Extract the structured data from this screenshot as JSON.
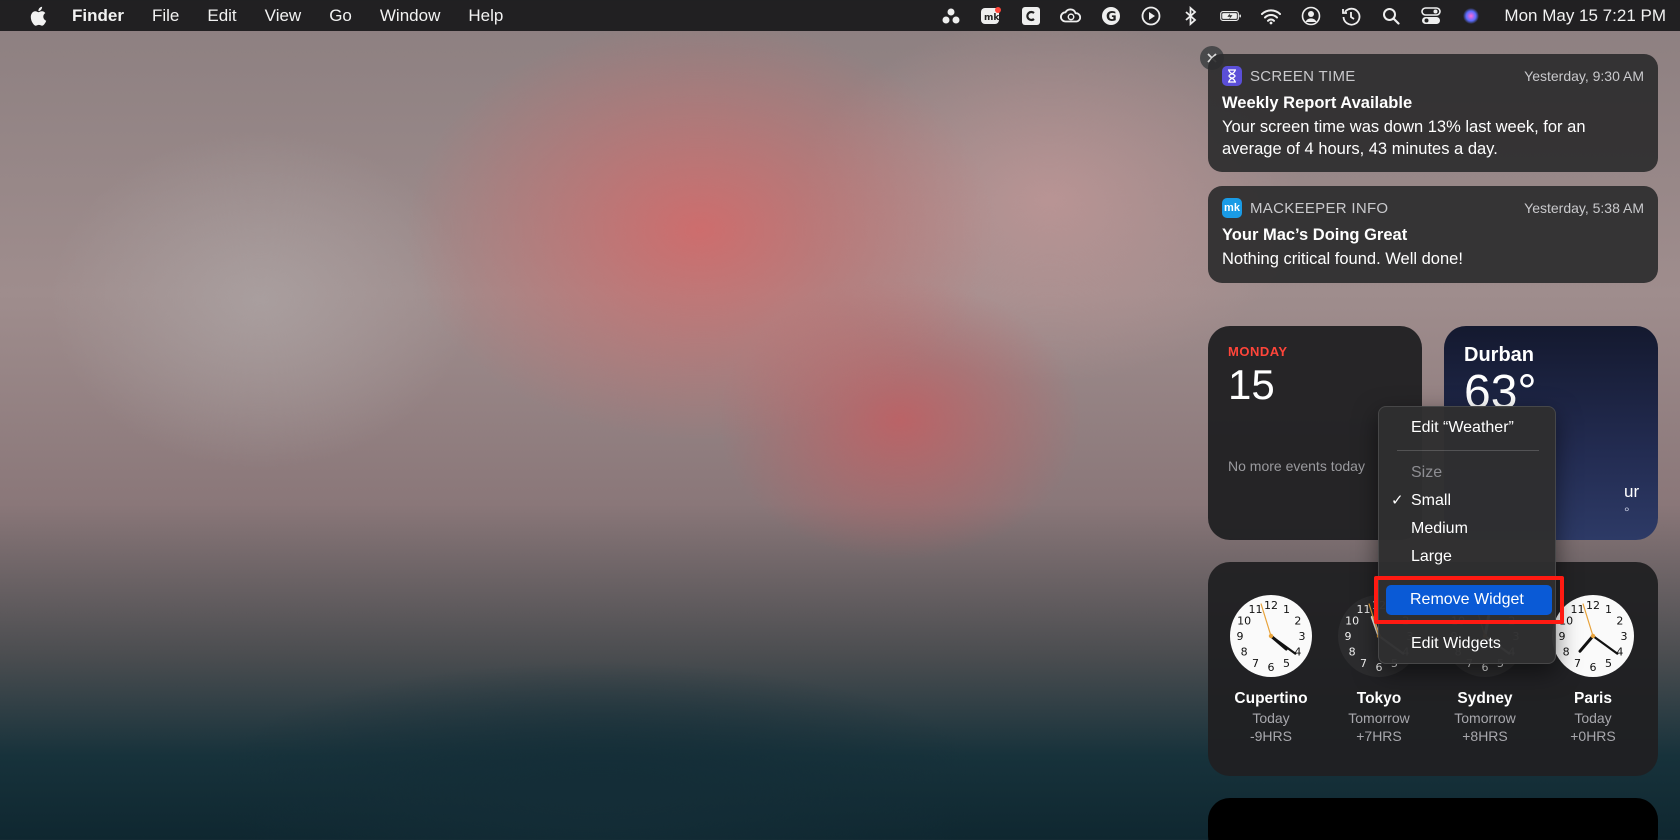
{
  "menubar": {
    "app_name": "Finder",
    "items": [
      "File",
      "Edit",
      "View",
      "Go",
      "Window",
      "Help"
    ],
    "datetime": "Mon May 15  7:21 PM"
  },
  "notifications": [
    {
      "app": "SCREEN TIME",
      "time": "Yesterday, 9:30 AM",
      "title": "Weekly Report Available",
      "body": "Your screen time was down 13% last week, for an average of 4 hours, 43 minutes a day.",
      "icon_color": "#5b4fd8"
    },
    {
      "app": "MACKEEPER INFO",
      "time": "Yesterday, 5:38 AM",
      "title": "Your Mac’s Doing Great",
      "body": "Nothing critical found. Well done!",
      "icon_color": "#1a9be6",
      "icon_text": "mk"
    }
  ],
  "calendar_widget": {
    "day": "MONDAY",
    "date": "15",
    "events": "No more events today"
  },
  "weather_widget": {
    "city": "Durban",
    "temp": "63°",
    "fragment1": "ur",
    "fragment2": "°"
  },
  "world_clock": [
    {
      "city": "Cupertino",
      "relative": "Today",
      "offset": "-9HRS",
      "face": "light",
      "hour": 4.35,
      "minute": 21
    },
    {
      "city": "Tokyo",
      "relative": "Tomorrow",
      "offset": "+7HRS",
      "face": "dark",
      "hour": 11.35,
      "minute": 21
    },
    {
      "city": "Sydney",
      "relative": "Tomorrow",
      "offset": "+8HRS",
      "face": "dark",
      "hour": 12.35,
      "minute": 21
    },
    {
      "city": "Paris",
      "relative": "Today",
      "offset": "+0HRS",
      "face": "light",
      "hour": 7.35,
      "minute": 21
    }
  ],
  "context_menu": {
    "edit_weather": "Edit “Weather”",
    "size_header": "Size",
    "sizes": [
      "Small",
      "Medium",
      "Large"
    ],
    "selected_size": "Small",
    "check_mark": "✓",
    "remove_widget": "Remove Widget",
    "edit_widgets": "Edit Widgets"
  },
  "colors": {
    "highlight_border": "#ff1a12",
    "selection_blue": "#0a5ad6",
    "calendar_red": "#ff453a"
  }
}
